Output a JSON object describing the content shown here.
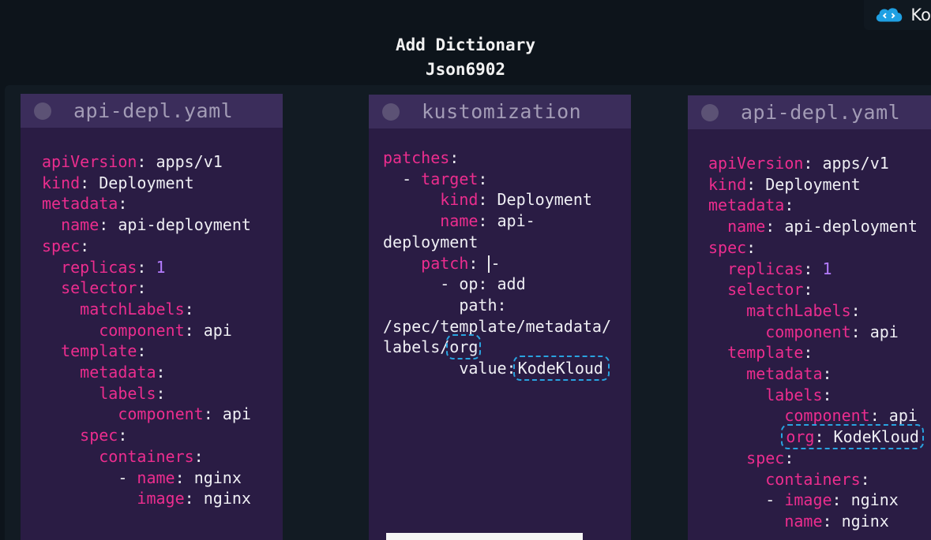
{
  "slide": {
    "title_line1": "Add Dictionary",
    "title_line2": "Json6902"
  },
  "brand": {
    "name": "Ko",
    "icon": "cloud-code-icon"
  },
  "colors": {
    "key": "#ec2d8e",
    "number": "#b57cff",
    "highlight": "#29a3e0",
    "panel": "#2a1c44",
    "header": "#3b2d5b"
  },
  "panels": {
    "left": {
      "title": "api-depl.yaml",
      "lines": {
        "l1": {
          "k": "apiVersion",
          "v": "apps/v1"
        },
        "l2": {
          "k": "kind",
          "v": "Deployment"
        },
        "l3": {
          "k": "metadata"
        },
        "l4": {
          "k": "name",
          "v": "api-deployment"
        },
        "l5": {
          "k": "spec"
        },
        "l6": {
          "k": "replicas",
          "v": "1"
        },
        "l7": {
          "k": "selector"
        },
        "l8": {
          "k": "matchLabels"
        },
        "l9": {
          "k": "component",
          "v": "api"
        },
        "l10": {
          "k": "template"
        },
        "l11": {
          "k": "metadata"
        },
        "l12": {
          "k": "labels"
        },
        "l13": {
          "k": "component",
          "v": "api"
        },
        "l14": {
          "k": "spec"
        },
        "l15": {
          "k": "containers"
        },
        "l16": {
          "k": "name",
          "v": "nginx"
        },
        "l17": {
          "k": "image",
          "v": "nginx"
        }
      }
    },
    "middle": {
      "title": "kustomization",
      "lines": {
        "l1": {
          "k": "patches"
        },
        "l2": {
          "k": "target"
        },
        "l3": {
          "k": "kind",
          "v": "Deployment"
        },
        "l4": {
          "k": "name",
          "v": "api-"
        },
        "l5": {
          "v": "deployment"
        },
        "l6": {
          "k": "patch",
          "v": "-"
        },
        "l7": {
          "v": "- op: add"
        },
        "l8": {
          "v": "path:"
        },
        "l9": {
          "v": "/spec/template/metadata/"
        },
        "l10": {
          "v": "labels/",
          "org": "org"
        },
        "l11": {
          "v": "value:",
          "val": "KodeKloud"
        }
      }
    },
    "right": {
      "title": "api-depl.yaml",
      "lines": {
        "l1": {
          "k": "apiVersion",
          "v": "apps/v1"
        },
        "l2": {
          "k": "kind",
          "v": "Deployment"
        },
        "l3": {
          "k": "metadata"
        },
        "l4": {
          "k": "name",
          "v": "api-deployment"
        },
        "l5": {
          "k": "spec"
        },
        "l6": {
          "k": "replicas",
          "v": "1"
        },
        "l7": {
          "k": "selector"
        },
        "l8": {
          "k": "matchLabels"
        },
        "l9": {
          "k": "component",
          "v": "api"
        },
        "l10": {
          "k": "template"
        },
        "l11": {
          "k": "metadata"
        },
        "l12": {
          "k": "labels"
        },
        "l13": {
          "k": "component",
          "v": "api"
        },
        "l14": {
          "k": "org",
          "v": "KodeKloud"
        },
        "l15": {
          "k": "spec"
        },
        "l16": {
          "k": "containers"
        },
        "l17": {
          "k": "image",
          "v": "nginx"
        },
        "l18": {
          "k": "name",
          "v": "nginx"
        }
      }
    }
  }
}
